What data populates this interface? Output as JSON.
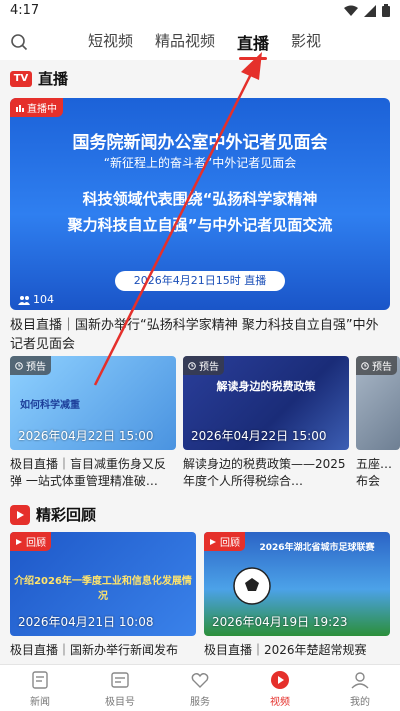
{
  "status": {
    "time": "4:17"
  },
  "tabs": [
    {
      "label": "短视频"
    },
    {
      "label": "精品视频"
    },
    {
      "label": "直播"
    },
    {
      "label": "影视"
    }
  ],
  "live_section": {
    "icon_text": "TV",
    "title": "直播",
    "hero": {
      "badge": "直播中",
      "line1": "国务院新闻办公室中外记者见面会",
      "line2": "“新征程上的奋斗者”中外记者见面会",
      "line3": "科技领域代表围绕“弘扬科学家精神",
      "line4": "聚力科技自立自强”与中外记者见面交流",
      "date": "2026年4月21日15时 直播",
      "viewers": "104",
      "caption": "极目直播｜国新办举行“弘扬科学家精神 聚力科技自立自强”中外记者见面会"
    },
    "cards": [
      {
        "badge": "预告",
        "time": "2026年04月22日 15:00",
        "thumb_text": "如何科学减重",
        "caption": "极目直播｜盲目减重伤身又反弹 一站式体重管理精准破…"
      },
      {
        "badge": "预告",
        "time": "2026年04月22日 15:00",
        "thumb_text": "解读身边的税费政策",
        "caption": "解读身边的税费政策——2025年度个人所得税综合…"
      },
      {
        "badge": "预告",
        "time": "",
        "thumb_text": "",
        "caption": "五座…布会"
      }
    ]
  },
  "replay_section": {
    "title": "精彩回顾",
    "cards": [
      {
        "badge": "回顾",
        "time": "2026年04月21日 10:08",
        "thumb_text": "介绍2026年一季度工业和信息化发展情况",
        "caption": "极目直播｜国新办举行新闻发布"
      },
      {
        "badge": "回顾",
        "time": "2026年04月19日 19:23",
        "thumb_text": "2026年湖北省城市足球联赛",
        "caption": "极目直播｜2026年楚超常规赛"
      }
    ]
  },
  "bottom_nav": [
    {
      "label": "新闻"
    },
    {
      "label": "极目号"
    },
    {
      "label": "服务"
    },
    {
      "label": "视频"
    },
    {
      "label": "我的"
    }
  ],
  "colors": {
    "accent": "#e5302b",
    "hero_blue": "#1c62d8"
  }
}
